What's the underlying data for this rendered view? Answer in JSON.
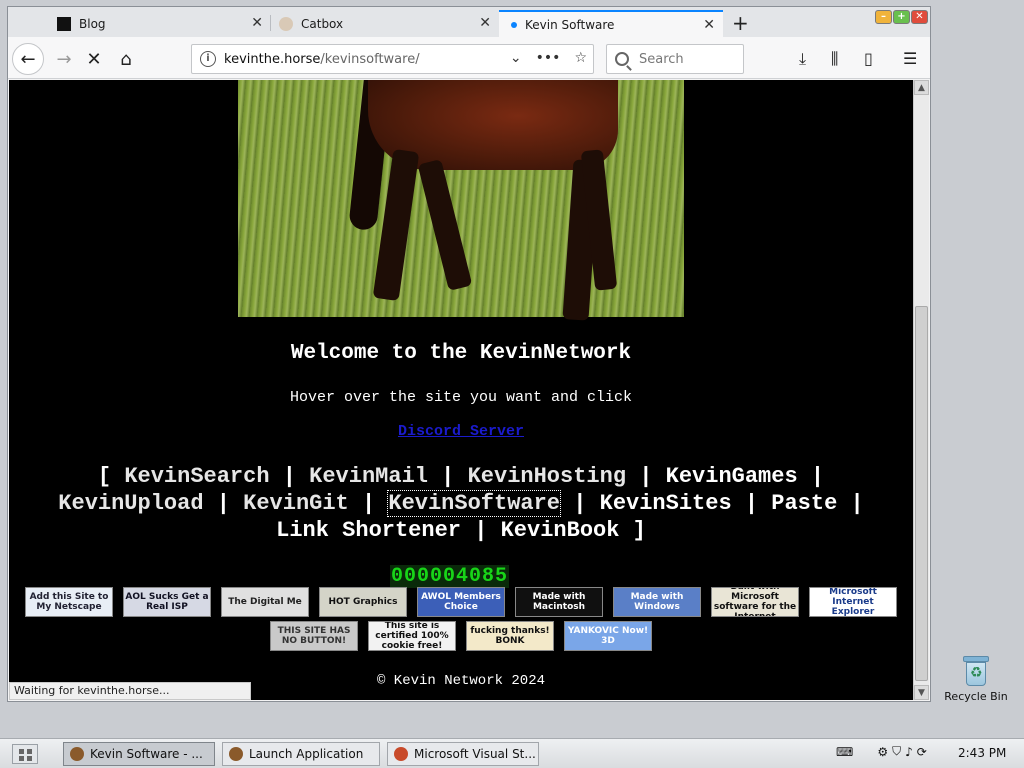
{
  "tabs": [
    {
      "label": "Blog"
    },
    {
      "label": "Catbox"
    },
    {
      "label": "Kevin Software"
    }
  ],
  "nav": {
    "url_host": "kevinthe.horse",
    "url_path": "/kevinsoftware/",
    "search_placeholder": "Search"
  },
  "page": {
    "welcome": "Welcome to the KevinNetwork",
    "hover_text": "Hover over the site you want and click",
    "discord_link": "Discord Server",
    "links": [
      "KevinSearch",
      "KevinMail",
      "KevinHosting",
      "KevinGames",
      "KevinUpload",
      "KevinGit",
      "KevinSoftware",
      "KevinSites",
      "Paste",
      "Link Shortener",
      "KevinBook"
    ],
    "counter": "000004085",
    "badges_row1": [
      {
        "text": "Add this Site to My Netscape"
      },
      {
        "text": "AOL Sucks Get a Real ISP"
      },
      {
        "text": "The Digital Me"
      },
      {
        "text": "HOT Graphics"
      },
      {
        "text": "AWOL Members Choice"
      },
      {
        "text": "Made with Macintosh"
      },
      {
        "text": "Made with Windows"
      },
      {
        "text": "Built with Microsoft software for the Internet"
      },
      {
        "text": "Microsoft Internet Explorer"
      }
    ],
    "badges_row2": [
      {
        "text": "THIS SITE HAS NO BUTTON!"
      },
      {
        "text": "This site is certified 100% cookie free!"
      },
      {
        "text": "fucking thanks! BONK"
      },
      {
        "text": "YANKOVIC Now! 3D"
      }
    ],
    "footer": "© Kevin Network 2024"
  },
  "status_text": "Waiting for kevinthe.horse...",
  "desktop": {
    "recycle_bin": "Recycle Bin"
  },
  "taskbar": {
    "items": [
      {
        "label": "Kevin Software - ..."
      },
      {
        "label": "Launch Application"
      },
      {
        "label": "Microsoft Visual St..."
      }
    ],
    "clock": "2:43 PM"
  },
  "colors": {
    "tab_accent": "#0a84ff",
    "counter_green": "#18d418",
    "link_blue": "#1b1bcc"
  }
}
